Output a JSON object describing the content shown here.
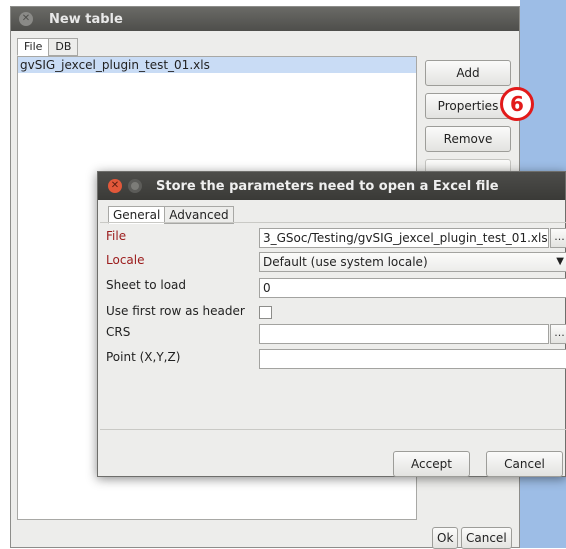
{
  "outer_window": {
    "title": "New table",
    "tabs": [
      {
        "label": "File",
        "active": true
      },
      {
        "label": "DB",
        "active": false
      }
    ],
    "files": [
      "gvSIG_jexcel_plugin_test_01.xls"
    ],
    "buttons": {
      "add": "Add",
      "properties": "Properties",
      "remove": "Remove",
      "ok": "Ok",
      "cancel": "Cancel"
    },
    "callout_number": "6"
  },
  "dialog": {
    "title": "Store the parameters need to open a Excel file",
    "tabs": [
      {
        "label": "General",
        "active": true
      },
      {
        "label": "Advanced",
        "active": false
      }
    ],
    "fields": {
      "file": {
        "label": "File",
        "value": "3_GSoc/Testing/gvSIG_jexcel_plugin_test_01.xls",
        "button": "..."
      },
      "locale": {
        "label": "Locale",
        "value": "Default (use system locale)"
      },
      "sheet": {
        "label": "Sheet to load",
        "value": "0"
      },
      "first_row_header": {
        "label": "Use first row as header",
        "checked": false
      },
      "crs": {
        "label": "CRS",
        "value": "",
        "button": "..."
      },
      "point": {
        "label": "Point (X,Y,Z)",
        "value": ""
      }
    },
    "buttons": {
      "accept": "Accept",
      "cancel": "Cancel"
    }
  },
  "colors": {
    "required_label": "#9b1b1b",
    "selection": "#c9dcf5",
    "callout": "#e21a1a",
    "desktop": "#9dbde6"
  }
}
